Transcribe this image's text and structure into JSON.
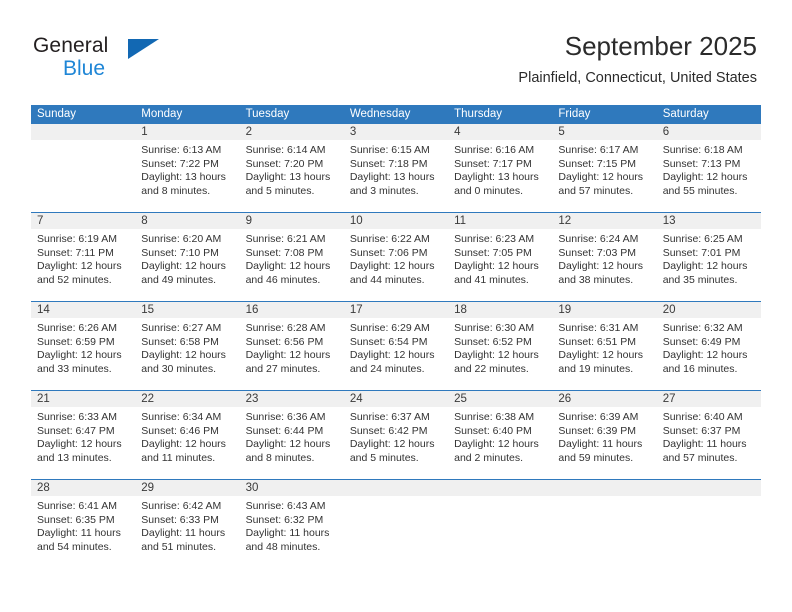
{
  "brand": {
    "name_part1": "General",
    "name_part2": "Blue",
    "blue": "#1f86d6",
    "dark": "#231f20"
  },
  "header": {
    "title": "September 2025",
    "subtitle": "Plainfield, Connecticut, United States"
  },
  "theme": {
    "header_blue": "#2f79bd",
    "daynum_band": "#f0f0f0"
  },
  "weekdays": [
    "Sunday",
    "Monday",
    "Tuesday",
    "Wednesday",
    "Thursday",
    "Friday",
    "Saturday"
  ],
  "weeks": [
    {
      "days": [
        {
          "num": "",
          "lines": []
        },
        {
          "num": "1",
          "lines": [
            "Sunrise: 6:13 AM",
            "Sunset: 7:22 PM",
            "Daylight: 13 hours",
            "and 8 minutes."
          ]
        },
        {
          "num": "2",
          "lines": [
            "Sunrise: 6:14 AM",
            "Sunset: 7:20 PM",
            "Daylight: 13 hours",
            "and 5 minutes."
          ]
        },
        {
          "num": "3",
          "lines": [
            "Sunrise: 6:15 AM",
            "Sunset: 7:18 PM",
            "Daylight: 13 hours",
            "and 3 minutes."
          ]
        },
        {
          "num": "4",
          "lines": [
            "Sunrise: 6:16 AM",
            "Sunset: 7:17 PM",
            "Daylight: 13 hours",
            "and 0 minutes."
          ]
        },
        {
          "num": "5",
          "lines": [
            "Sunrise: 6:17 AM",
            "Sunset: 7:15 PM",
            "Daylight: 12 hours",
            "and 57 minutes."
          ]
        },
        {
          "num": "6",
          "lines": [
            "Sunrise: 6:18 AM",
            "Sunset: 7:13 PM",
            "Daylight: 12 hours",
            "and 55 minutes."
          ]
        }
      ]
    },
    {
      "days": [
        {
          "num": "7",
          "lines": [
            "Sunrise: 6:19 AM",
            "Sunset: 7:11 PM",
            "Daylight: 12 hours",
            "and 52 minutes."
          ]
        },
        {
          "num": "8",
          "lines": [
            "Sunrise: 6:20 AM",
            "Sunset: 7:10 PM",
            "Daylight: 12 hours",
            "and 49 minutes."
          ]
        },
        {
          "num": "9",
          "lines": [
            "Sunrise: 6:21 AM",
            "Sunset: 7:08 PM",
            "Daylight: 12 hours",
            "and 46 minutes."
          ]
        },
        {
          "num": "10",
          "lines": [
            "Sunrise: 6:22 AM",
            "Sunset: 7:06 PM",
            "Daylight: 12 hours",
            "and 44 minutes."
          ]
        },
        {
          "num": "11",
          "lines": [
            "Sunrise: 6:23 AM",
            "Sunset: 7:05 PM",
            "Daylight: 12 hours",
            "and 41 minutes."
          ]
        },
        {
          "num": "12",
          "lines": [
            "Sunrise: 6:24 AM",
            "Sunset: 7:03 PM",
            "Daylight: 12 hours",
            "and 38 minutes."
          ]
        },
        {
          "num": "13",
          "lines": [
            "Sunrise: 6:25 AM",
            "Sunset: 7:01 PM",
            "Daylight: 12 hours",
            "and 35 minutes."
          ]
        }
      ]
    },
    {
      "days": [
        {
          "num": "14",
          "lines": [
            "Sunrise: 6:26 AM",
            "Sunset: 6:59 PM",
            "Daylight: 12 hours",
            "and 33 minutes."
          ]
        },
        {
          "num": "15",
          "lines": [
            "Sunrise: 6:27 AM",
            "Sunset: 6:58 PM",
            "Daylight: 12 hours",
            "and 30 minutes."
          ]
        },
        {
          "num": "16",
          "lines": [
            "Sunrise: 6:28 AM",
            "Sunset: 6:56 PM",
            "Daylight: 12 hours",
            "and 27 minutes."
          ]
        },
        {
          "num": "17",
          "lines": [
            "Sunrise: 6:29 AM",
            "Sunset: 6:54 PM",
            "Daylight: 12 hours",
            "and 24 minutes."
          ]
        },
        {
          "num": "18",
          "lines": [
            "Sunrise: 6:30 AM",
            "Sunset: 6:52 PM",
            "Daylight: 12 hours",
            "and 22 minutes."
          ]
        },
        {
          "num": "19",
          "lines": [
            "Sunrise: 6:31 AM",
            "Sunset: 6:51 PM",
            "Daylight: 12 hours",
            "and 19 minutes."
          ]
        },
        {
          "num": "20",
          "lines": [
            "Sunrise: 6:32 AM",
            "Sunset: 6:49 PM",
            "Daylight: 12 hours",
            "and 16 minutes."
          ]
        }
      ]
    },
    {
      "days": [
        {
          "num": "21",
          "lines": [
            "Sunrise: 6:33 AM",
            "Sunset: 6:47 PM",
            "Daylight: 12 hours",
            "and 13 minutes."
          ]
        },
        {
          "num": "22",
          "lines": [
            "Sunrise: 6:34 AM",
            "Sunset: 6:46 PM",
            "Daylight: 12 hours",
            "and 11 minutes."
          ]
        },
        {
          "num": "23",
          "lines": [
            "Sunrise: 6:36 AM",
            "Sunset: 6:44 PM",
            "Daylight: 12 hours",
            "and 8 minutes."
          ]
        },
        {
          "num": "24",
          "lines": [
            "Sunrise: 6:37 AM",
            "Sunset: 6:42 PM",
            "Daylight: 12 hours",
            "and 5 minutes."
          ]
        },
        {
          "num": "25",
          "lines": [
            "Sunrise: 6:38 AM",
            "Sunset: 6:40 PM",
            "Daylight: 12 hours",
            "and 2 minutes."
          ]
        },
        {
          "num": "26",
          "lines": [
            "Sunrise: 6:39 AM",
            "Sunset: 6:39 PM",
            "Daylight: 11 hours",
            "and 59 minutes."
          ]
        },
        {
          "num": "27",
          "lines": [
            "Sunrise: 6:40 AM",
            "Sunset: 6:37 PM",
            "Daylight: 11 hours",
            "and 57 minutes."
          ]
        }
      ]
    },
    {
      "days": [
        {
          "num": "28",
          "lines": [
            "Sunrise: 6:41 AM",
            "Sunset: 6:35 PM",
            "Daylight: 11 hours",
            "and 54 minutes."
          ]
        },
        {
          "num": "29",
          "lines": [
            "Sunrise: 6:42 AM",
            "Sunset: 6:33 PM",
            "Daylight: 11 hours",
            "and 51 minutes."
          ]
        },
        {
          "num": "30",
          "lines": [
            "Sunrise: 6:43 AM",
            "Sunset: 6:32 PM",
            "Daylight: 11 hours",
            "and 48 minutes."
          ]
        },
        {
          "num": "",
          "lines": []
        },
        {
          "num": "",
          "lines": []
        },
        {
          "num": "",
          "lines": []
        },
        {
          "num": "",
          "lines": []
        }
      ]
    }
  ]
}
